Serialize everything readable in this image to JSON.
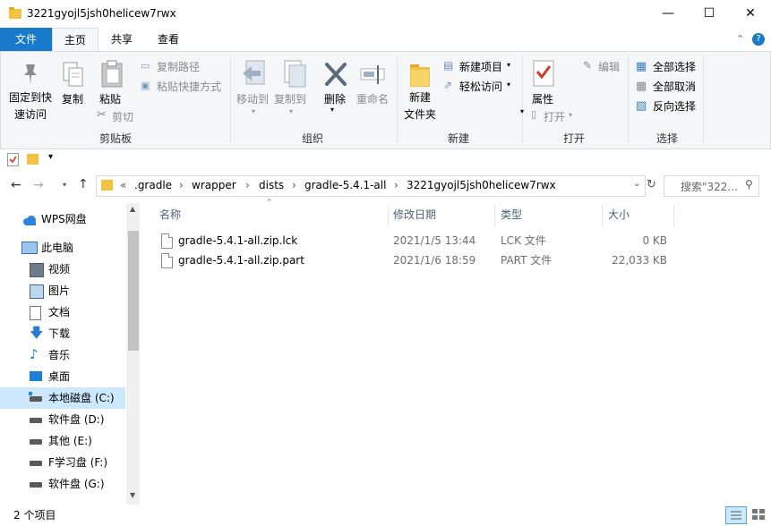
{
  "window": {
    "title": "3221gyojl5jsh0helicew7rwx",
    "minimize": "—",
    "maximize": "☐",
    "close": "✕"
  },
  "ribbon_tabs": {
    "file": "文件",
    "home": "主页",
    "share": "共享",
    "view": "查看"
  },
  "ribbon": {
    "clipboard": {
      "pin_line1": "固定到快",
      "pin_line2": "速访问",
      "copy": "复制",
      "paste": "粘贴",
      "copy_path": "复制路径",
      "paste_shortcut": "粘贴快捷方式",
      "cut": "剪切",
      "label": "剪贴板"
    },
    "organize": {
      "move_to": "移动到",
      "copy_to": "复制到",
      "delete": "删除",
      "rename": "重命名",
      "label": "组织"
    },
    "new": {
      "new_folder_line1": "新建",
      "new_folder_line2": "文件夹",
      "new_item": "新建项目",
      "easy_access": "轻松访问",
      "label": "新建"
    },
    "open": {
      "properties": "属性",
      "open": "打开",
      "edit": "编辑",
      "label": "打开"
    },
    "select": {
      "select_all": "全部选择",
      "select_none": "全部取消",
      "invert": "反向选择",
      "label": "选择"
    }
  },
  "address": {
    "prefix": "«",
    "crumbs": [
      ".gradle",
      "wrapper",
      "dists",
      "gradle-5.4.1-all",
      "3221gyojl5jsh0helicew7rwx"
    ],
    "search_placeholder": "搜索\"322..."
  },
  "nav": {
    "items": [
      {
        "label": "WPS网盘",
        "icon": "cloud-icon"
      },
      {
        "label": "此电脑",
        "icon": "computer-icon"
      },
      {
        "label": "视频",
        "icon": "video-icon"
      },
      {
        "label": "图片",
        "icon": "picture-icon"
      },
      {
        "label": "文档",
        "icon": "document-icon"
      },
      {
        "label": "下载",
        "icon": "download-icon"
      },
      {
        "label": "音乐",
        "icon": "music-icon"
      },
      {
        "label": "桌面",
        "icon": "desktop-icon"
      },
      {
        "label": "本地磁盘 (C:)",
        "icon": "drive-icon"
      },
      {
        "label": "软件盘 (D:)",
        "icon": "drive-icon"
      },
      {
        "label": "其他 (E:)",
        "icon": "drive-icon"
      },
      {
        "label": "F学习盘 (F:)",
        "icon": "drive-icon"
      },
      {
        "label": "软件盘 (G:)",
        "icon": "drive-icon"
      }
    ]
  },
  "columns": {
    "name": "名称",
    "modified": "修改日期",
    "type": "类型",
    "size": "大小"
  },
  "files": [
    {
      "name": "gradle-5.4.1-all.zip.lck",
      "modified": "2021/1/5 13:44",
      "type": "LCK 文件",
      "size": "0 KB"
    },
    {
      "name": "gradle-5.4.1-all.zip.part",
      "modified": "2021/1/6 18:59",
      "type": "PART 文件",
      "size": "22,033 KB"
    }
  ],
  "status": {
    "count": "2 个项目"
  },
  "colors": {
    "accent": "#1979ca",
    "selected_nav": "#cce8ff",
    "ribbon_bg": "#f5f6f7"
  }
}
